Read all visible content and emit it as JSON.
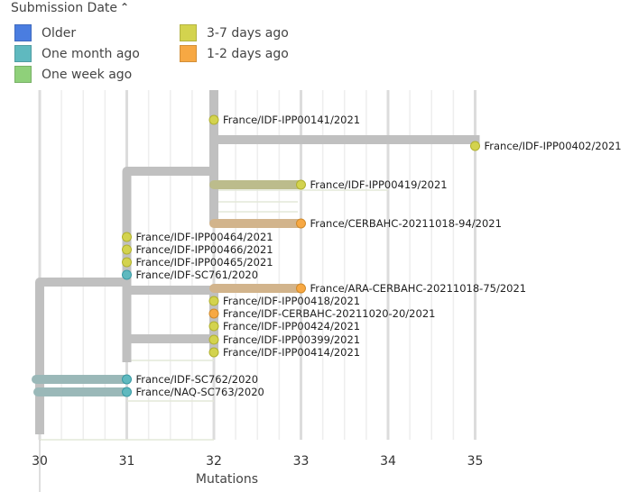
{
  "legend": {
    "title": "Submission Date",
    "toggle_icon": "chevron-up-icon",
    "items": [
      {
        "label": "Older",
        "color": "#4a7de0"
      },
      {
        "label": "One month ago",
        "color": "#5fb9bf"
      },
      {
        "label": "One week ago",
        "color": "#8fd07a"
      },
      {
        "label": "3-7 days ago",
        "color": "#d3d34e"
      },
      {
        "label": "1-2 days ago",
        "color": "#f7a843"
      }
    ]
  },
  "chart_data": {
    "type": "phylogenetic-tree",
    "xlabel": "Mutations",
    "xlim": [
      30,
      35
    ],
    "x_ticks": [
      "30",
      "31",
      "32",
      "33",
      "34",
      "35"
    ],
    "branch_colors": {
      "internal": "#c0c0c0",
      "one_month_ago": "#9ab8b8",
      "three_to_seven_days": "#bcbc8c",
      "one_to_two_days": "#d2b48c"
    },
    "tips": [
      {
        "name": "France/IDF-IPP00141/2021",
        "mutations": 32,
        "category": "3-7 days ago"
      },
      {
        "name": "France/IDF-IPP00402/2021",
        "mutations": 35,
        "category": "3-7 days ago"
      },
      {
        "name": "France/IDF-IPP00419/2021",
        "mutations": 33,
        "category": "3-7 days ago"
      },
      {
        "name": "France/CERBAHC-20211018-94/2021",
        "mutations": 33,
        "category": "1-2 days ago"
      },
      {
        "name": "France/IDF-IPP00464/2021",
        "mutations": 31,
        "category": "3-7 days ago"
      },
      {
        "name": "France/IDF-IPP00466/2021",
        "mutations": 31,
        "category": "3-7 days ago"
      },
      {
        "name": "France/IDF-IPP00465/2021",
        "mutations": 31,
        "category": "3-7 days ago"
      },
      {
        "name": "France/IDF-SC761/2020",
        "mutations": 31,
        "category": "One month ago"
      },
      {
        "name": "France/ARA-CERBAHC-20211018-75/2021",
        "mutations": 33,
        "category": "1-2 days ago"
      },
      {
        "name": "France/IDF-IPP00418/2021",
        "mutations": 32,
        "category": "3-7 days ago"
      },
      {
        "name": "France/IDF-CERBAHC-20211020-20/2021",
        "mutations": 32,
        "category": "1-2 days ago"
      },
      {
        "name": "France/IDF-IPP00424/2021",
        "mutations": 32,
        "category": "3-7 days ago"
      },
      {
        "name": "France/IDF-IPP00399/2021",
        "mutations": 32,
        "category": "3-7 days ago"
      },
      {
        "name": "France/IDF-IPP00414/2021",
        "mutations": 32,
        "category": "3-7 days ago"
      },
      {
        "name": "France/IDF-SC762/2020",
        "mutations": 31,
        "category": "One month ago"
      },
      {
        "name": "France/NAQ-SC763/2020",
        "mutations": 31,
        "category": "One month ago"
      }
    ]
  }
}
